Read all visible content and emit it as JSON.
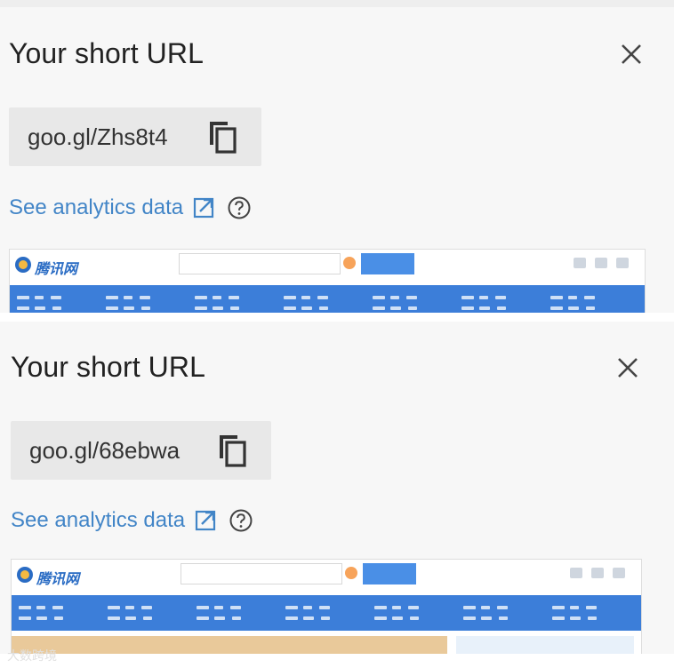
{
  "dialogs": [
    {
      "title": "Your short URL",
      "short_url": "goo.gl/Zhs8t4",
      "analytics_link": "See analytics data"
    },
    {
      "title": "Your short URL",
      "short_url": "goo.gl/68ebwa",
      "analytics_link": "See analytics data"
    }
  ],
  "icons": {
    "close": "close-icon",
    "copy": "copy-icon",
    "external": "open-in-new-icon",
    "help": "help-icon"
  },
  "colors": {
    "link": "#4285c7",
    "preview_nav": "#3c7ed9"
  },
  "preview": {
    "logo_text": "腾讯网"
  },
  "watermark": "大数跨境"
}
